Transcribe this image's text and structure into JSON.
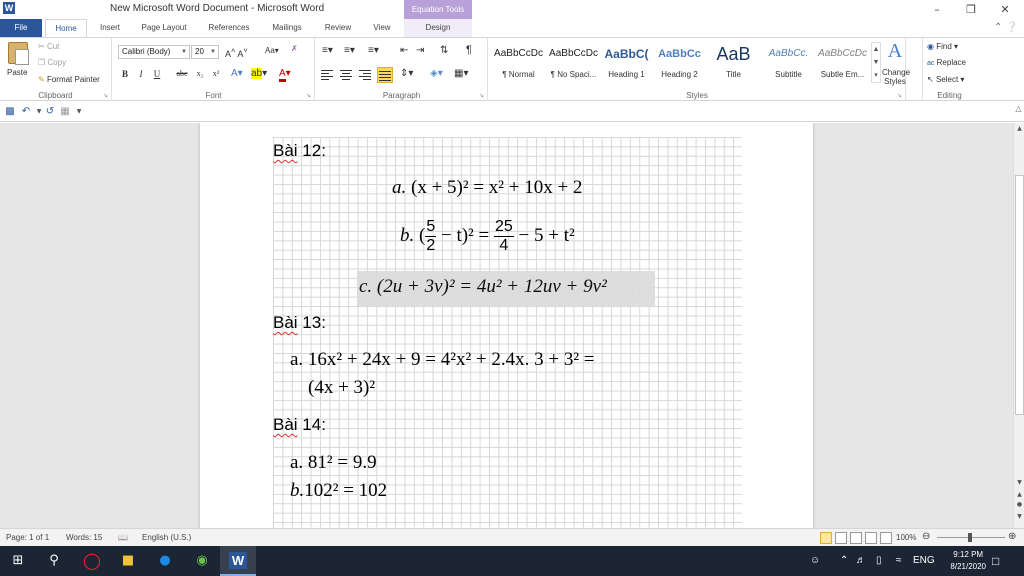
{
  "window": {
    "title": "New Microsoft Word Document  -  Microsoft Word",
    "context_tab_title": "Equation Tools",
    "logo": "W"
  },
  "tabs": [
    "File",
    "Home",
    "Insert",
    "Page Layout",
    "References",
    "Mailings",
    "Review",
    "View",
    "Design"
  ],
  "ribbon": {
    "clipboard": {
      "label": "Clipboard",
      "paste": "Paste",
      "cut": "Cut",
      "copy": "Copy",
      "format_painter": "Format Painter"
    },
    "font": {
      "label": "Font",
      "font_name": "Calibri (Body)",
      "font_size": "20",
      "bold": "B",
      "italic": "I",
      "underline": "U",
      "strike": "abc",
      "subscript": "x₂",
      "superscript": "x²"
    },
    "paragraph": {
      "label": "Paragraph"
    },
    "styles": {
      "label": "Styles",
      "items": [
        {
          "sample": "AaBbCcDc",
          "name": "¶ Normal"
        },
        {
          "sample": "AaBbCcDc",
          "name": "¶ No Spaci..."
        },
        {
          "sample": "AaBbC(",
          "name": "Heading 1"
        },
        {
          "sample": "AaBbCc",
          "name": "Heading 2"
        },
        {
          "sample": "AaB",
          "name": "Title"
        },
        {
          "sample": "AaBbCc.",
          "name": "Subtitle"
        },
        {
          "sample": "AaBbCcDc",
          "name": "Subtle Em..."
        }
      ],
      "change_styles": "Change Styles"
    },
    "editing": {
      "label": "Editing",
      "find": "Find",
      "replace": "Replace",
      "select": "Select"
    }
  },
  "document": {
    "b12_heading": "Bài",
    "b12_num": " 12:",
    "eq_a_label": "a.",
    "eq_a": "(x + 5)² = x² + 10x + 2",
    "eq_b_label": "b.",
    "eq_b_pre": "(",
    "eq_b_frac1_num": "5",
    "eq_b_frac1_den": "2",
    "eq_b_mid": " − t)² = ",
    "eq_b_frac2_num": "25",
    "eq_b_frac2_den": "4",
    "eq_b_post": " − 5 + t²",
    "eq_c": "c. (2u + 3v)² = 4u² + 12uv + 9v²",
    "b13_heading": "Bài",
    "b13_num": " 13:",
    "eq_13a_line1": "a. 16x² + 24x + 9 = 4²x² + 2.4x. 3 + 3² =",
    "eq_13a_line2": "(4x + 3)²",
    "b14_heading": "Bài",
    "b14_num": " 14:",
    "eq_14a": "a. 81² = 9.9",
    "eq_14b_label": "b.",
    "eq_14b": "102² = 102"
  },
  "status": {
    "page": "Page: 1 of 1",
    "words": "Words: 15",
    "language": "English (U.S.)",
    "zoom": "100%"
  },
  "taskbar": {
    "lang": "ENG",
    "time": "9:12 PM",
    "date": "8/21/2020"
  }
}
